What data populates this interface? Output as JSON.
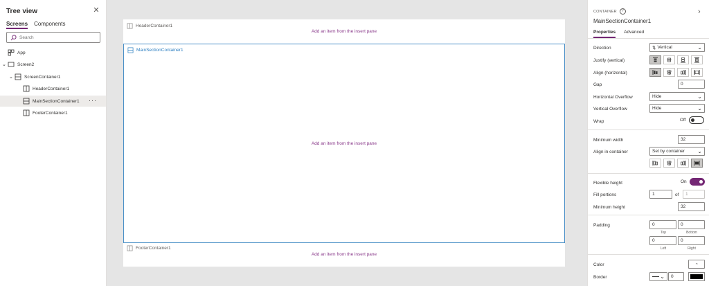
{
  "tree": {
    "title": "Tree view",
    "tabs": [
      "Screens",
      "Components"
    ],
    "search_placeholder": "Search",
    "nodes": {
      "app": "App",
      "screen2": "Screen2",
      "screen_container": "ScreenContainer1",
      "header": "HeaderContainer1",
      "main": "MainSectionContainer1",
      "footer": "FooterContainer1"
    },
    "more": "···"
  },
  "canvas": {
    "header_label": "HeaderContainer1",
    "main_label": "MainSectionContainer1",
    "footer_label": "FooterContainer1",
    "hint": "Add an item from the insert pane"
  },
  "props": {
    "category": "CONTAINER",
    "name": "MainSectionContainer1",
    "tabs": [
      "Properties",
      "Advanced"
    ],
    "direction_label": "Direction",
    "direction_value": "Vertical",
    "justify_label": "Justify (vertical)",
    "align_label": "Align (horizontal)",
    "gap_label": "Gap",
    "gap_value": "0",
    "hoverflow_label": "Horizontal Overflow",
    "hoverflow_value": "Hide",
    "voverflow_label": "Vertical Overflow",
    "voverflow_value": "Hide",
    "wrap_label": "Wrap",
    "wrap_state": "Off",
    "minwidth_label": "Minimum width",
    "minwidth_value": "32",
    "align_in_container_label": "Align in container",
    "align_in_container_value": "Set by container",
    "flexheight_label": "Flexible height",
    "flexheight_state": "On",
    "fill_label": "Fill portions",
    "fill_value": "1",
    "fill_of": "of",
    "fill_total": "1",
    "minheight_label": "Minimum height",
    "minheight_value": "32",
    "padding_label": "Padding",
    "padding_top": "0",
    "padding_bottom": "0",
    "padding_left": "0",
    "padding_right": "0",
    "top_label": "Top",
    "bottom_label": "Bottom",
    "left_label": "Left",
    "right_label": "Right",
    "color_label": "Color",
    "border_label": "Border",
    "border_width": "0",
    "accent": "#742774"
  }
}
